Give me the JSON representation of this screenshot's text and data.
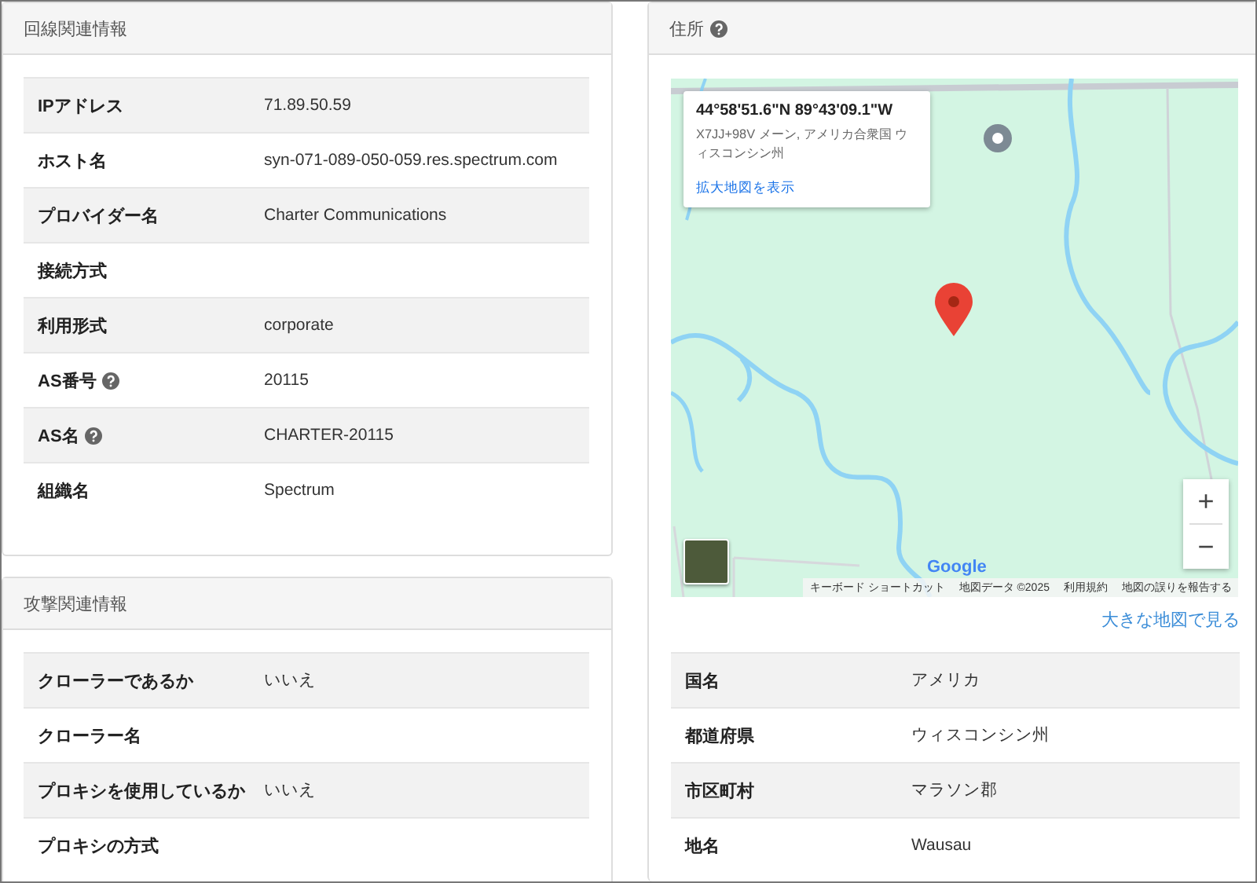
{
  "left_panels": [
    {
      "title": "回線関連情報",
      "rows": [
        {
          "label": "IPアドレス",
          "value": "71.89.50.59",
          "help": false
        },
        {
          "label": "ホスト名",
          "value": "syn-071-089-050-059.res.spectrum.com",
          "help": false
        },
        {
          "label": "プロバイダー名",
          "value": "Charter Communications",
          "help": false
        },
        {
          "label": "接続方式",
          "help": false
        },
        {
          "label": "利用形式",
          "value": "corporate",
          "help": false
        },
        {
          "label": "AS番号",
          "value": "20115",
          "help": true
        },
        {
          "label": "AS名",
          "value": "CHARTER-20115",
          "help": true
        },
        {
          "label": "組織名",
          "value": "Spectrum",
          "help": false
        }
      ]
    },
    {
      "title": "攻撃関連情報",
      "rows": [
        {
          "label": "クローラーであるか",
          "value": "いいえ",
          "help": false
        },
        {
          "label": "クローラー名",
          "help": false
        },
        {
          "label": "プロキシを使用しているか",
          "value": "いいえ",
          "help": false
        },
        {
          "label": "プロキシの方式",
          "help": false
        }
      ]
    }
  ],
  "address_panel": {
    "title": "住所",
    "map": {
      "popup": {
        "coords": "44°58'51.6\"N 89°43'09.1\"W",
        "address": "X7JJ+98V メーン, アメリカ合衆国 ウィスコンシン州",
        "link": "拡大地図を表示"
      },
      "logo": "Google",
      "attribution": [
        "キーボード ショートカット",
        "地図データ ©2025",
        "利用規約",
        "地図の誤りを報告する"
      ],
      "zoom_in": "+",
      "zoom_out": "−"
    },
    "large_map_link": "大きな地図で見る",
    "rows": [
      {
        "label": "国名",
        "value": "アメリカ"
      },
      {
        "label": "都道府県",
        "value": "ウィスコンシン州"
      },
      {
        "label": "市区町村",
        "value": "マラソン郡"
      },
      {
        "label": "地名",
        "value": "Wausau"
      }
    ]
  }
}
